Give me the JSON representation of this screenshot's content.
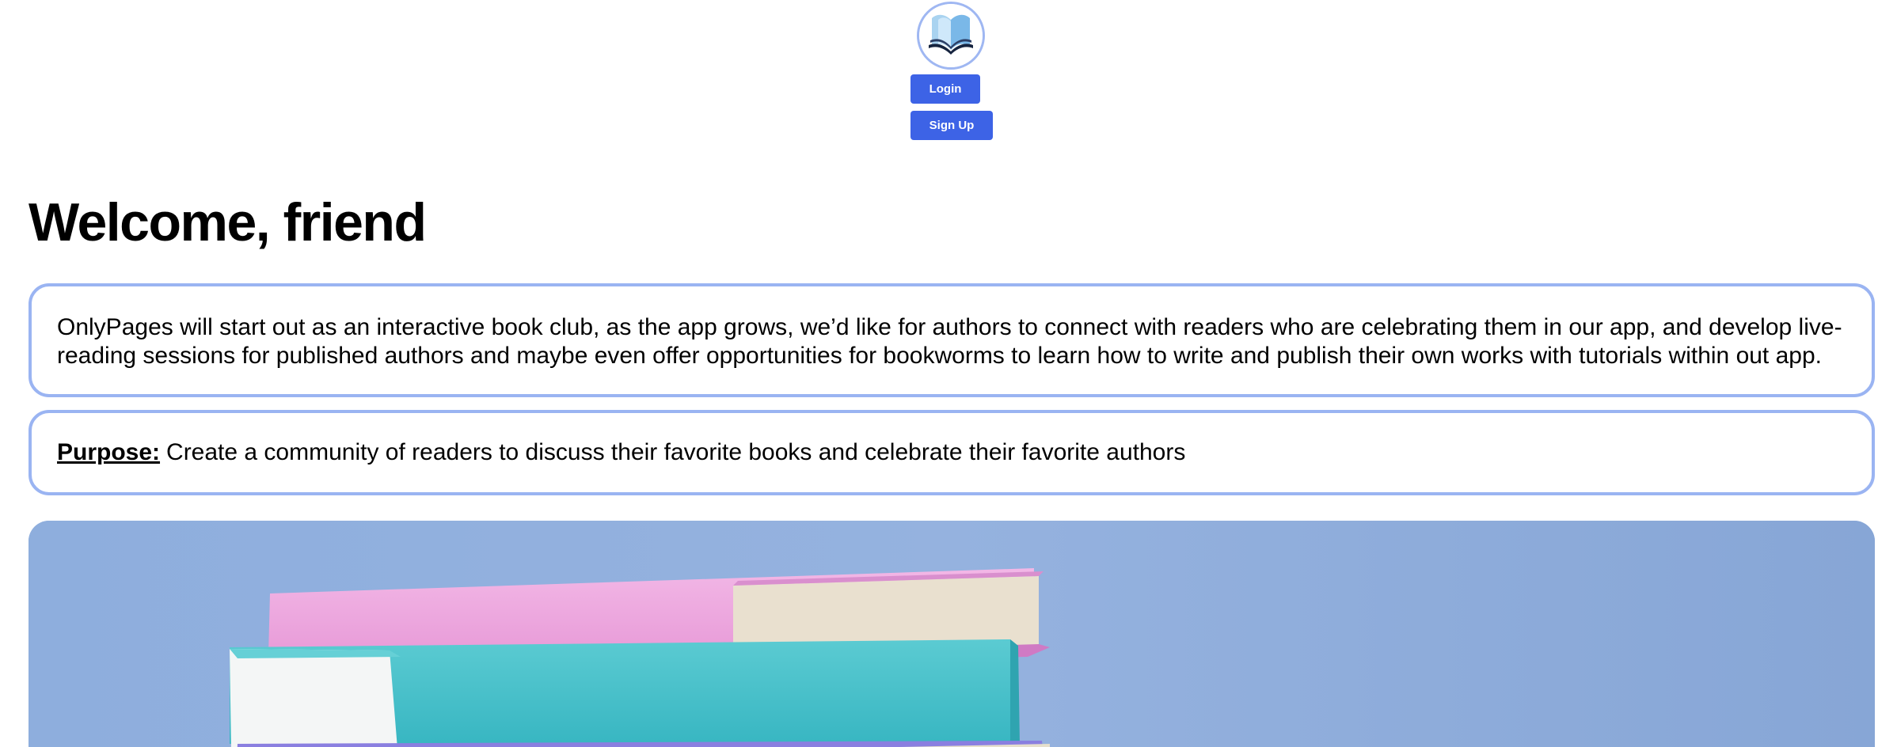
{
  "header": {
    "logo_icon": "open-book-icon",
    "login_label": "Login",
    "signup_label": "Sign Up"
  },
  "main": {
    "greeting": "Welcome, friend",
    "description": "OnlyPages will start out as an interactive book club, as the app grows, we’d like for authors to connect with readers who are celebrating them in our app, and develop live-reading sessions for published authors and maybe even offer opportunities for bookworms to learn how to write and publish their own works with tutorials within out app.",
    "purpose_label": "Purpose:",
    "purpose_text": "Create a community of readers to discuss their favorite books and celebrate their favorite authors",
    "hero_image": "stack-of-books-photo"
  },
  "colors": {
    "accent": "#3d63e6",
    "card_border": "#9ab4f2",
    "hero_background": "#90aedc"
  }
}
